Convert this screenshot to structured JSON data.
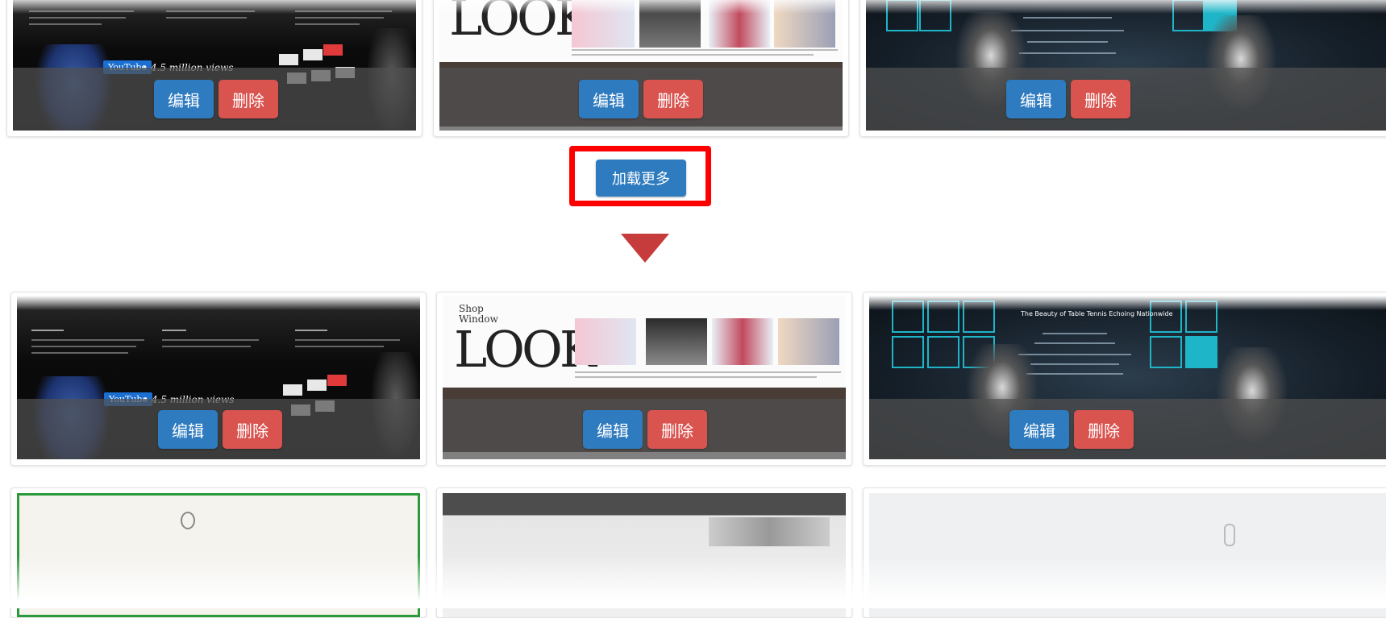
{
  "buttons": {
    "edit_label": "编辑",
    "delete_label": "删除",
    "load_more_label": "加载更多"
  },
  "colors": {
    "edit": "#2f7bbf",
    "delete": "#d9534f",
    "highlight": "#ff0000",
    "arrow": "#c63b3b"
  },
  "thumbnails": {
    "look_brand": "LOOK",
    "look_subtitle": "Shop Window",
    "youtube_badge": "YouTube",
    "youtube_text": "• 4.5 million views",
    "tennis_title": "The Beauty of Table Tennis Echoing Nationwide"
  },
  "icons": [
    "down-arrow-icon"
  ]
}
